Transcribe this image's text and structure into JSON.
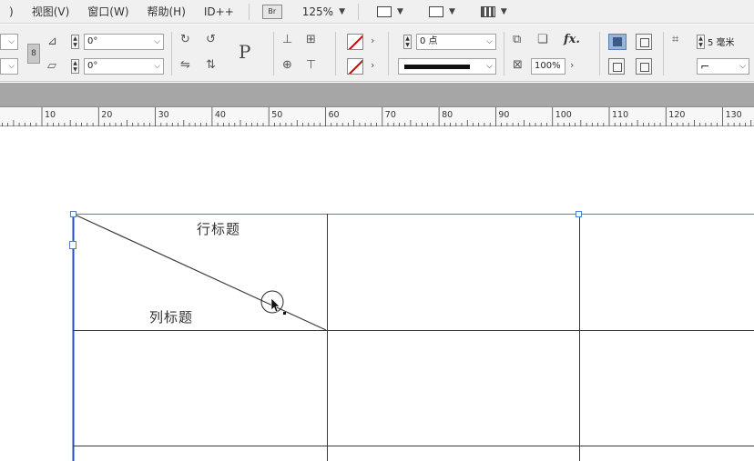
{
  "menubar": {
    "items": [
      {
        "id": "partial",
        "label": ")"
      },
      {
        "id": "view",
        "label": "视图(V)"
      },
      {
        "id": "window",
        "label": "窗口(W)"
      },
      {
        "id": "help",
        "label": "帮助(H)"
      },
      {
        "id": "idpp",
        "label": "ID++"
      }
    ],
    "bridge_label": "Br",
    "zoom": "125%"
  },
  "control_panel": {
    "rotation_angle": "0°",
    "shear_angle": "0°",
    "stroke_weight": "0 点",
    "opacity": "100%",
    "fx_label": "fx.",
    "text_frame_label": "P",
    "measure_partial": "5 毫米"
  },
  "ruler": {
    "labels": [
      "10",
      "20",
      "30",
      "40",
      "50",
      "60",
      "70",
      "80",
      "90",
      "100",
      "110",
      "120",
      "130"
    ]
  },
  "table": {
    "row_header_label": "行标题",
    "column_header_label": "列标题"
  },
  "colors": {
    "selection_blue": "#4a7fd0",
    "table_line": "#3a3a3a",
    "stroke_none_red": "#d00000"
  }
}
